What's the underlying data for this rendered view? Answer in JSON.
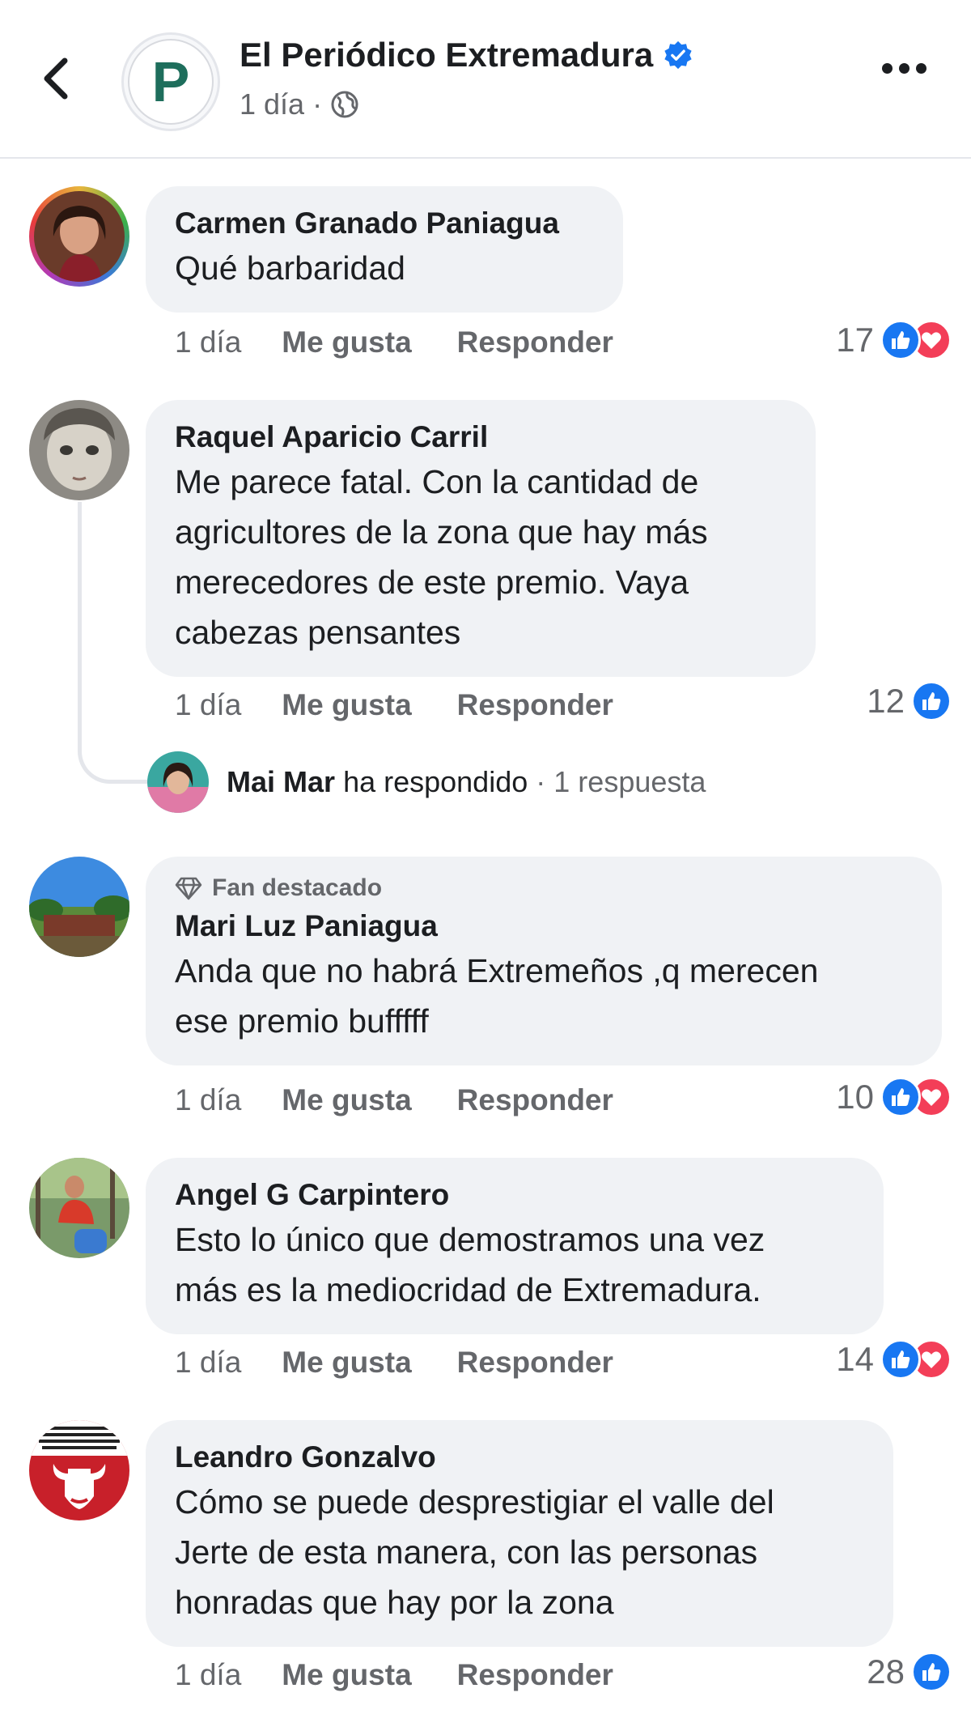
{
  "header": {
    "page_name": "El Periódico Extremadura",
    "avatar_letter": "P",
    "post_time": "1 día",
    "separator": "·"
  },
  "labels": {
    "like": "Me gusta",
    "reply": "Responder"
  },
  "comments": [
    {
      "author": "Carmen Granado Paniagua",
      "lines": [
        "Qué barbaridad"
      ],
      "time": "1 día",
      "reaction_count": "17",
      "reactions": [
        "like-icon",
        "love-icon"
      ]
    },
    {
      "author": "Raquel Aparicio Carril",
      "lines": [
        "Me parece fatal. Con la cantidad de",
        "agricultores de la zona que hay más",
        "merecedores de este premio. Vaya",
        "cabezas pensantes"
      ],
      "time": "1 día",
      "reaction_count": "12",
      "reactions": [
        "like-icon"
      ],
      "reply": {
        "name": "Mai Mar",
        "action": "ha respondido",
        "separator": "·",
        "count": "1 respuesta"
      }
    },
    {
      "badge": "Fan destacado",
      "author": "Mari Luz Paniagua",
      "lines": [
        "Anda que no habrá Extremeños ,q merecen",
        "ese premio bufffff"
      ],
      "time": "1 día",
      "reaction_count": "10",
      "reactions": [
        "like-icon",
        "love-icon"
      ]
    },
    {
      "author": "Angel G Carpintero",
      "lines": [
        "Esto lo único que demostramos una vez",
        "más es la mediocridad de Extremadura."
      ],
      "time": "1 día",
      "reaction_count": "14",
      "reactions": [
        "like-icon",
        "love-icon"
      ]
    },
    {
      "author": "Leandro Gonzalvo",
      "lines": [
        "Cómo se puede desprestigiar el valle del",
        "Jerte de esta manera, con las personas",
        "honradas que hay por la zona"
      ],
      "time": "1 día",
      "reaction_count": "28",
      "reactions": [
        "like-icon"
      ]
    }
  ],
  "colors": {
    "like": "#1877f2",
    "love": "#f33e58",
    "bubble": "#f0f2f5",
    "secondary_text": "#65676b"
  }
}
